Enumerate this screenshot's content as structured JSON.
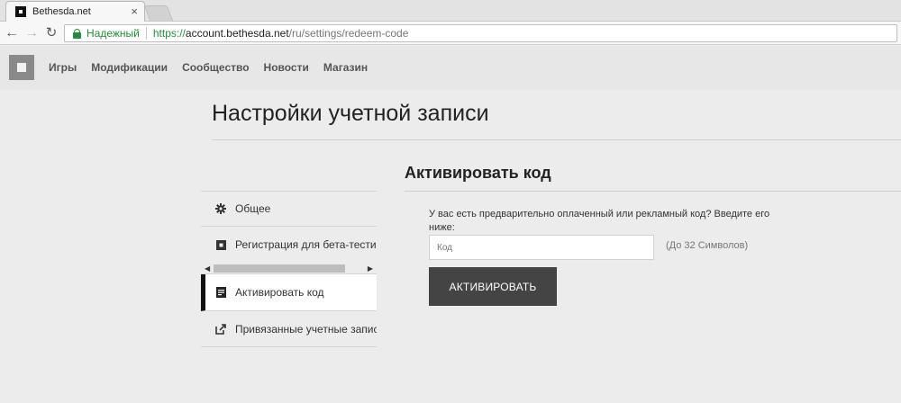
{
  "browser": {
    "tab_title": "Bethesda.net",
    "tab_close": "×",
    "secure_label": "Надежный",
    "url_protocol": "https://",
    "url_host": "account.bethesda.net",
    "url_path": "/ru/settings/redeem-code"
  },
  "site_nav": {
    "items": [
      "Игры",
      "Модификации",
      "Сообщество",
      "Новости",
      "Магазин"
    ]
  },
  "page": {
    "title": "Настройки учетной записи"
  },
  "sidebar": {
    "items": [
      {
        "label": "Общее",
        "icon": "gear-icon"
      },
      {
        "label": "Регистрация для бета-тестирования",
        "icon": "square-icon"
      },
      {
        "label": "Активировать код",
        "icon": "document-icon",
        "active": true
      },
      {
        "label": "Привязанные учетные записи",
        "icon": "link-out-icon"
      }
    ]
  },
  "redeem": {
    "title": "Активировать код",
    "prompt": "У вас есть предварительно оплаченный или рекламный код? Введите его ниже:",
    "input_placeholder": "Код",
    "input_value": "",
    "hint": "(До 32 Символов)",
    "button_label": "АКТИВИРОВАТЬ"
  },
  "colors": {
    "secure_green": "#1e8f3c",
    "button_bg": "#444444",
    "active_indicator": "#111111",
    "page_bg": "#ececec"
  }
}
